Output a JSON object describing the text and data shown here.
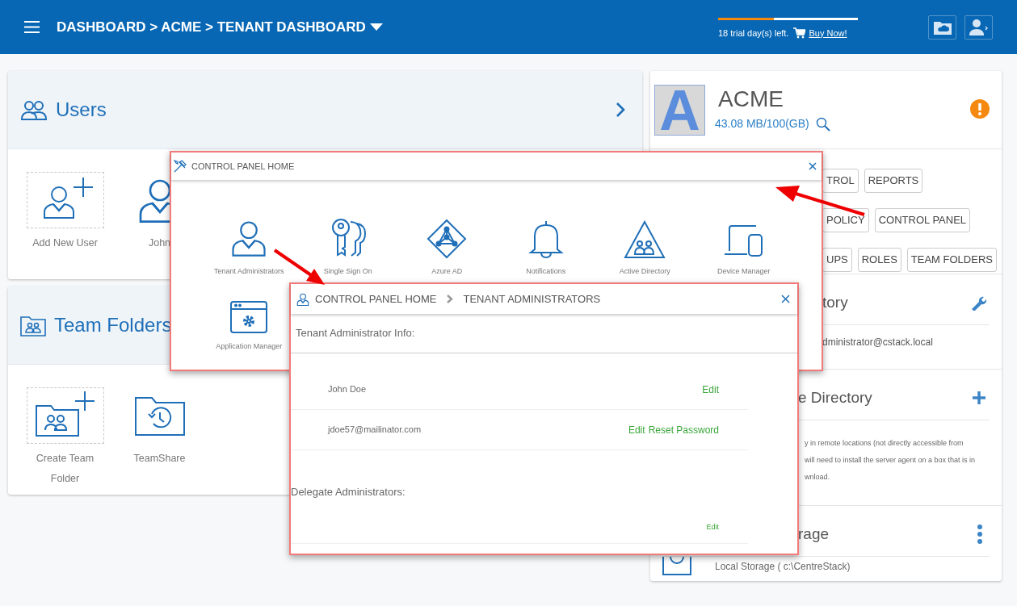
{
  "header": {
    "breadcrumb": "DASHBOARD > ACME > TENANT DASHBOARD",
    "trial": {
      "level": 0.4,
      "text": "18 trial day(s) left.",
      "link": "Buy Now!"
    }
  },
  "users_card": {
    "title": "Users",
    "tiles": [
      {
        "kind": "add-user",
        "label": "Add New User"
      },
      {
        "kind": "user",
        "label": "John"
      }
    ]
  },
  "team_folders_card": {
    "title": "Team Folders",
    "tiles": [
      {
        "kind": "add-folder",
        "label": "Create Team Folder"
      },
      {
        "kind": "history-folder",
        "label": "TeamShare"
      }
    ]
  },
  "tenant": {
    "logo_letter": "A",
    "name": "ACME",
    "storage": "43.08 MB/100(GB)",
    "button_rows": [
      [
        "TROL",
        "REPORTS"
      ],
      [
        "POLICY",
        "CONTROL PANEL"
      ],
      [
        "UPS",
        "ROLES",
        "TEAM FOLDERS"
      ]
    ],
    "sections": [
      {
        "kind": "directory",
        "title": "tory",
        "lines": [
          "dministrator@cstack.local"
        ]
      },
      {
        "kind": "remote",
        "title": "e Directory",
        "lines": [
          "y in remote locations (not directly accessible from",
          "will need to install the server agent on a box that is in",
          "wnload."
        ]
      },
      {
        "kind": "storage",
        "title": "rage",
        "lines": [
          "Local Storage ( c:\\CentreStack)"
        ]
      }
    ]
  },
  "control_panel": {
    "title": "CONTROL PANEL HOME",
    "items": [
      {
        "kind": "tenant-admins",
        "label": "Tenant Administrators"
      },
      {
        "kind": "sso",
        "label": "Single Sign On"
      },
      {
        "kind": "azure",
        "label": "Azure AD"
      },
      {
        "kind": "notifications",
        "label": "Notifications"
      },
      {
        "kind": "active-directory",
        "label": "Active Directory"
      },
      {
        "kind": "devices",
        "label": "Device Manager"
      },
      {
        "kind": "apps",
        "label": "Application Manager"
      }
    ]
  },
  "tenant_admins": {
    "crumbs": [
      "CONTROL PANEL HOME",
      "TENANT ADMINISTRATORS"
    ],
    "info_label": "Tenant Administrator Info:",
    "rows": [
      {
        "value": "John Doe",
        "actions": [
          "Edit"
        ]
      },
      {
        "value": "jdoe57@mailinator.com",
        "actions": [
          "Edit",
          "Reset Password"
        ]
      }
    ],
    "delegate_label": "Delegate Administrators:",
    "delegate_actions": [
      "Edit"
    ]
  }
}
